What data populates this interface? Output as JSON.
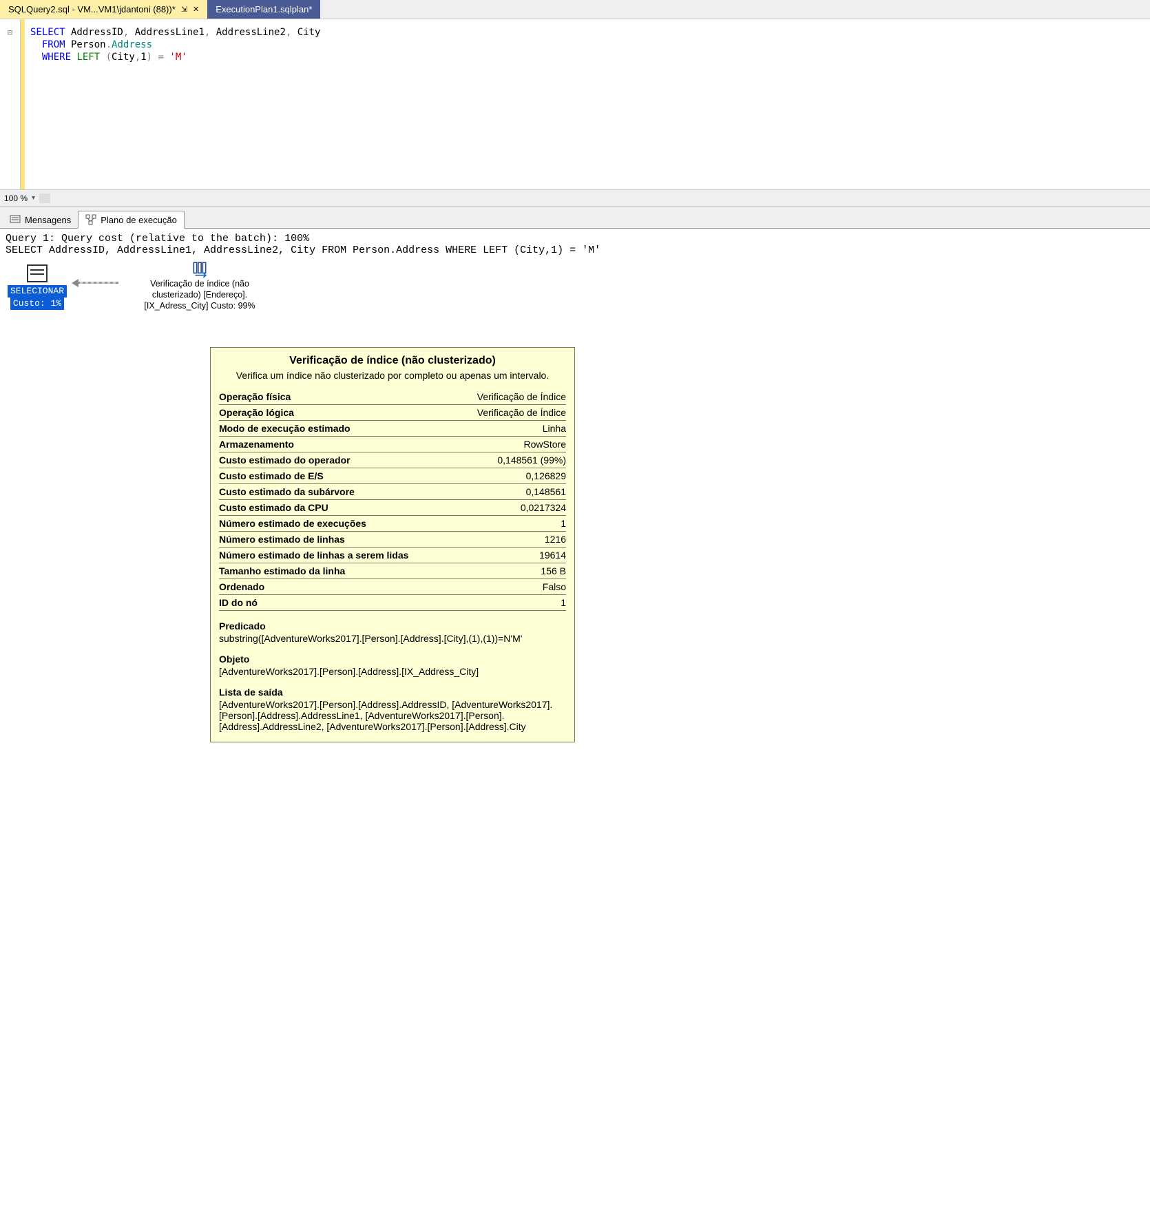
{
  "tabs": {
    "active": {
      "label": "SQLQuery2.sql - VM...VM1\\jdantoni (88))*",
      "pin": "⇲",
      "close": "✕"
    },
    "inactive": {
      "label": "ExecutionPlan1.sqlplan*"
    }
  },
  "editor": {
    "outline_glyph": "⊟",
    "code_tokens": [
      {
        "cls": "kw-blue",
        "t": "SELECT"
      },
      {
        "cls": "",
        "t": " AddressID"
      },
      {
        "cls": "kw-gray",
        "t": ","
      },
      {
        "cls": "",
        "t": " AddressLine1"
      },
      {
        "cls": "kw-gray",
        "t": ","
      },
      {
        "cls": "",
        "t": " AddressLine2"
      },
      {
        "cls": "kw-gray",
        "t": ","
      },
      {
        "cls": "",
        "t": " City\n  "
      },
      {
        "cls": "kw-blue",
        "t": "FROM"
      },
      {
        "cls": "",
        "t": " Person"
      },
      {
        "cls": "kw-gray",
        "t": "."
      },
      {
        "cls": "kw-teal",
        "t": "Address"
      },
      {
        "cls": "",
        "t": "\n  "
      },
      {
        "cls": "kw-blue",
        "t": "WHERE"
      },
      {
        "cls": "",
        "t": " "
      },
      {
        "cls": "kw-green",
        "t": "LEFT"
      },
      {
        "cls": "",
        "t": " "
      },
      {
        "cls": "kw-gray",
        "t": "("
      },
      {
        "cls": "",
        "t": "City"
      },
      {
        "cls": "kw-gray",
        "t": ","
      },
      {
        "cls": "",
        "t": "1"
      },
      {
        "cls": "kw-gray",
        "t": ")"
      },
      {
        "cls": "",
        "t": " "
      },
      {
        "cls": "kw-gray",
        "t": "="
      },
      {
        "cls": "",
        "t": " "
      },
      {
        "cls": "kw-red",
        "t": "'M'"
      },
      {
        "cls": "",
        "t": "\n\n\n\n"
      }
    ]
  },
  "zoom": {
    "value": "100 %",
    "chev": "▾"
  },
  "lower_tabs": {
    "messages": "Mensagens",
    "plan": "Plano de execução"
  },
  "plan_header": {
    "line1": "Query 1: Query cost (relative to the batch): 100%",
    "line2": "SELECT AddressID, AddressLine1, AddressLine2, City FROM Person.Address WHERE LEFT (City,1) = 'M'"
  },
  "plan_ops": {
    "select": {
      "label": "SELECIONAR",
      "cost": "Custo: 1%"
    },
    "scan": {
      "line1": "Verificação de índice (não",
      "line2": "clusterizado) [Endereço].",
      "line3": "[IX_Adress_City] Custo: 99%"
    }
  },
  "tooltip": {
    "title": "Verificação de índice (não clusterizado)",
    "desc": "Verifica um índice não clusterizado por completo ou apenas um intervalo.",
    "rows": [
      {
        "k": "Operação física",
        "v": "Verificação de Índice"
      },
      {
        "k": "Operação lógica",
        "v": "Verificação de Índice"
      },
      {
        "k": "Modo de execução estimado",
        "v": "Linha"
      },
      {
        "k": "Armazenamento",
        "v": "RowStore"
      },
      {
        "k": "Custo estimado do operador",
        "v": "0,148561 (99%)"
      },
      {
        "k": "Custo estimado de E/S",
        "v": "0,126829"
      },
      {
        "k": "Custo estimado da subárvore",
        "v": "0,148561"
      },
      {
        "k": "Custo estimado da CPU",
        "v": "0,0217324"
      },
      {
        "k": "Número estimado de execuções",
        "v": "1"
      },
      {
        "k": "Número estimado de linhas",
        "v": "1216"
      },
      {
        "k": "Número estimado de linhas a serem lidas",
        "v": "19614"
      },
      {
        "k": "Tamanho estimado da linha",
        "v": "156 B"
      },
      {
        "k": "Ordenado",
        "v": "Falso"
      },
      {
        "k": "ID do nó",
        "v": "1"
      }
    ],
    "blocks": [
      {
        "lbl": "Predicado",
        "val": "substring([AdventureWorks2017].[Person].[Address].[City],(1),(1))=N'M'"
      },
      {
        "lbl": "Objeto",
        "val": "[AdventureWorks2017].[Person].[Address].[IX_Address_City]"
      },
      {
        "lbl": "Lista de saída",
        "val": "[AdventureWorks2017].[Person].[Address].AddressID, [AdventureWorks2017].[Person].[Address].AddressLine1, [AdventureWorks2017].[Person].[Address].AddressLine2, [AdventureWorks2017].[Person].[Address].City"
      }
    ]
  }
}
